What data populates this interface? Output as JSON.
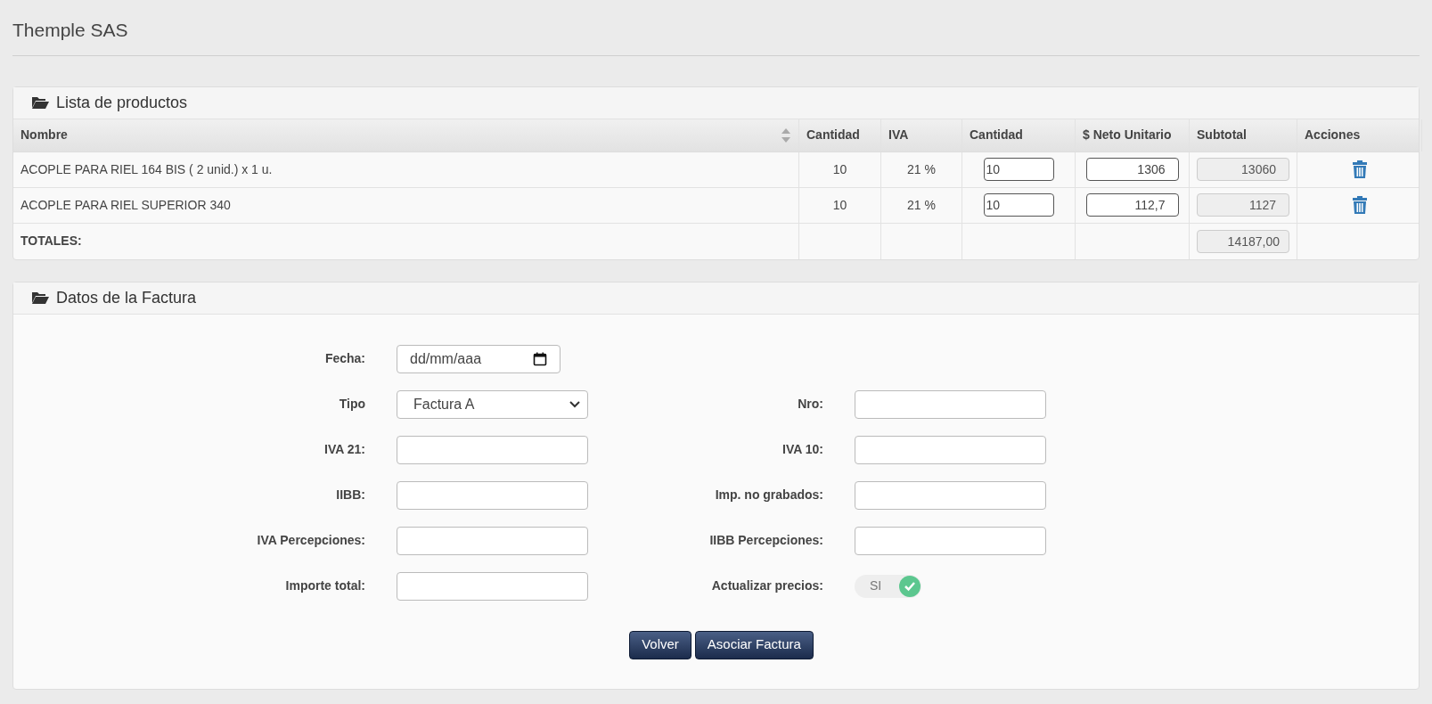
{
  "page": {
    "title": "Themple SAS"
  },
  "products": {
    "title": "Lista de productos",
    "columns": [
      {
        "label": "Nombre",
        "sortable": true
      },
      {
        "label": "Cantidad",
        "sortable": false
      },
      {
        "label": "IVA",
        "sortable": false
      },
      {
        "label": "Cantidad",
        "sortable": false
      },
      {
        "label": "$ Neto Unitario",
        "sortable": false
      },
      {
        "label": "Subtotal",
        "sortable": false
      },
      {
        "label": "Acciones",
        "sortable": false
      }
    ],
    "rows": [
      {
        "name": "ACOPLE PARA RIEL 164 BIS ( 2 unid.) x 1 u.",
        "quantity": "10",
        "iva": "21 %",
        "quantity_input": "10",
        "net_unit": "1306",
        "subtotal": "13060"
      },
      {
        "name": "ACOPLE PARA RIEL SUPERIOR 340",
        "quantity": "10",
        "iva": "21 %",
        "quantity_input": "10",
        "net_unit": "112,7",
        "subtotal": "1127"
      }
    ],
    "totals": {
      "label": "TOTALES:",
      "subtotal": "14187,00"
    }
  },
  "invoice": {
    "title": "Datos de la Factura",
    "rows": [
      {
        "left": {
          "kind": "date",
          "label": "Fecha:",
          "placeholder": "dd/mm/aaa"
        }
      },
      {
        "left": {
          "kind": "select",
          "label": "Tipo",
          "value": "Factura A"
        },
        "right": {
          "kind": "text",
          "label": "Nro:"
        }
      },
      {
        "left": {
          "kind": "text",
          "label": "IVA 21:"
        },
        "right": {
          "kind": "text",
          "label": "IVA 10:"
        }
      },
      {
        "left": {
          "kind": "text",
          "label": "IIBB:"
        },
        "right": {
          "kind": "text",
          "label": "Imp. no grabados:"
        }
      },
      {
        "left": {
          "kind": "text",
          "label": "IVA Percepciones:"
        },
        "right": {
          "kind": "text",
          "label": "IIBB Percepciones:"
        }
      },
      {
        "left": {
          "kind": "text",
          "label": "Importe total:"
        },
        "right": {
          "kind": "toggle",
          "label": "Actualizar precios:",
          "on": true,
          "text": "SI"
        }
      }
    ],
    "buttons": [
      "Volver",
      "Asociar Factura"
    ]
  }
}
